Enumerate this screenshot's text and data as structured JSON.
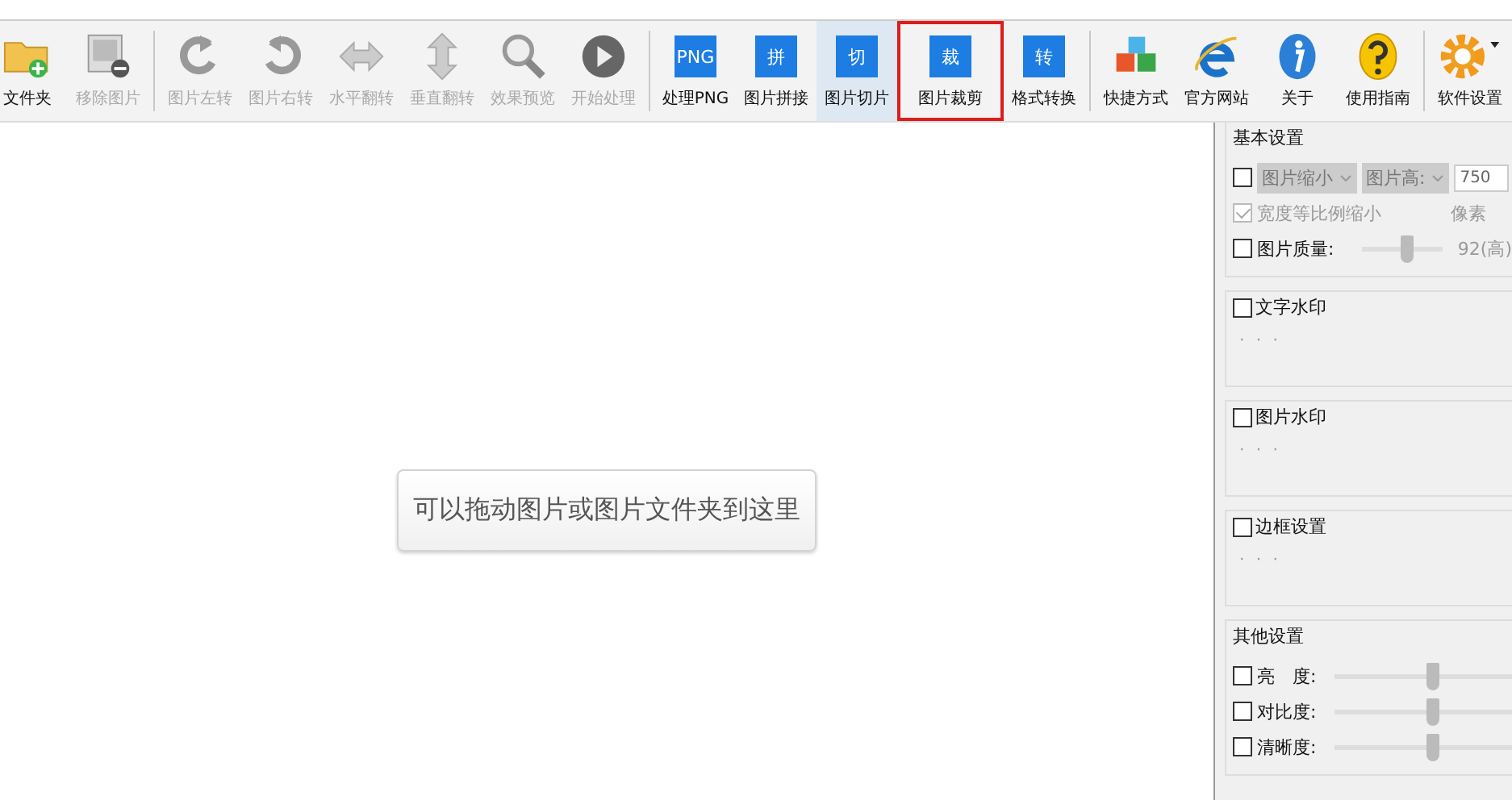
{
  "toolbar": {
    "groups": [
      [
        {
          "label": "文件夹",
          "kind": "drawing",
          "disabled": false,
          "hovered": false,
          "highlighted": false
        },
        {
          "label": "移除图片",
          "kind": "drawing",
          "disabled": true,
          "hovered": false,
          "highlighted": false
        }
      ],
      [
        {
          "label": "图片左转",
          "kind": "drawing",
          "disabled": true,
          "hovered": false,
          "highlighted": false
        },
        {
          "label": "图片右转",
          "kind": "drawing",
          "disabled": true,
          "hovered": false,
          "highlighted": false
        },
        {
          "label": "水平翻转",
          "kind": "drawing",
          "disabled": true,
          "hovered": false,
          "highlighted": false
        },
        {
          "label": "垂直翻转",
          "kind": "drawing",
          "disabled": true,
          "hovered": false,
          "highlighted": false
        },
        {
          "label": "效果预览",
          "kind": "drawing",
          "disabled": true,
          "hovered": false,
          "highlighted": false
        },
        {
          "label": "开始处理",
          "kind": "drawing",
          "disabled": true,
          "hovered": false,
          "highlighted": false
        }
      ],
      [
        {
          "label": "处理PNG",
          "kind": "tile",
          "glyph": "PNG",
          "disabled": false,
          "hovered": false,
          "highlighted": false
        },
        {
          "label": "图片拼接",
          "kind": "tile",
          "glyph": "拼",
          "disabled": false,
          "hovered": false,
          "highlighted": false
        },
        {
          "label": "图片切片",
          "kind": "tile",
          "glyph": "切",
          "disabled": false,
          "hovered": true,
          "highlighted": false
        },
        {
          "label": "图片裁剪",
          "kind": "tile",
          "glyph": "裁",
          "disabled": false,
          "hovered": false,
          "highlighted": true
        },
        {
          "label": "格式转换",
          "kind": "tile",
          "glyph": "转",
          "disabled": false,
          "hovered": false,
          "highlighted": false
        }
      ],
      [
        {
          "label": "快捷方式",
          "kind": "drawing",
          "disabled": false,
          "hovered": false,
          "highlighted": false
        },
        {
          "label": "官方网站",
          "kind": "drawing",
          "disabled": false,
          "hovered": false,
          "highlighted": false
        },
        {
          "label": "关于",
          "kind": "drawing",
          "disabled": false,
          "hovered": false,
          "highlighted": false
        },
        {
          "label": "使用指南",
          "kind": "drawing",
          "disabled": false,
          "hovered": false,
          "highlighted": false
        }
      ],
      [
        {
          "label": "软件设置",
          "kind": "drawing",
          "disabled": false,
          "hovered": false,
          "highlighted": false
        }
      ]
    ]
  },
  "drop_hint": "可以拖动图片或图片文件夹到这里",
  "settings": {
    "basic": {
      "title": "基本设置",
      "resize": {
        "checked": false,
        "mode": "图片缩小",
        "dimension": "图片高:",
        "value": "750"
      },
      "proportional": {
        "label": "宽度等比例缩小",
        "checked": true,
        "disabled": true
      },
      "unit": "像素",
      "quality": {
        "label": "图片质量:",
        "checked": false,
        "level": 0.55,
        "reading": "92(高)"
      }
    },
    "sections": [
      {
        "title": "文字水印",
        "checked": false,
        "summary": "· · ·"
      },
      {
        "title": "图片水印",
        "checked": false,
        "summary": "· · ·"
      },
      {
        "title": "边框设置",
        "checked": false,
        "summary": "· · ·"
      }
    ],
    "other": {
      "title": "其他设置",
      "sliders": [
        {
          "label": "亮　度:",
          "checked": false,
          "level": 0.55
        },
        {
          "label": "对比度:",
          "checked": false,
          "level": 0.55
        },
        {
          "label": "清晰度:",
          "checked": false,
          "level": 0.55
        }
      ]
    }
  }
}
